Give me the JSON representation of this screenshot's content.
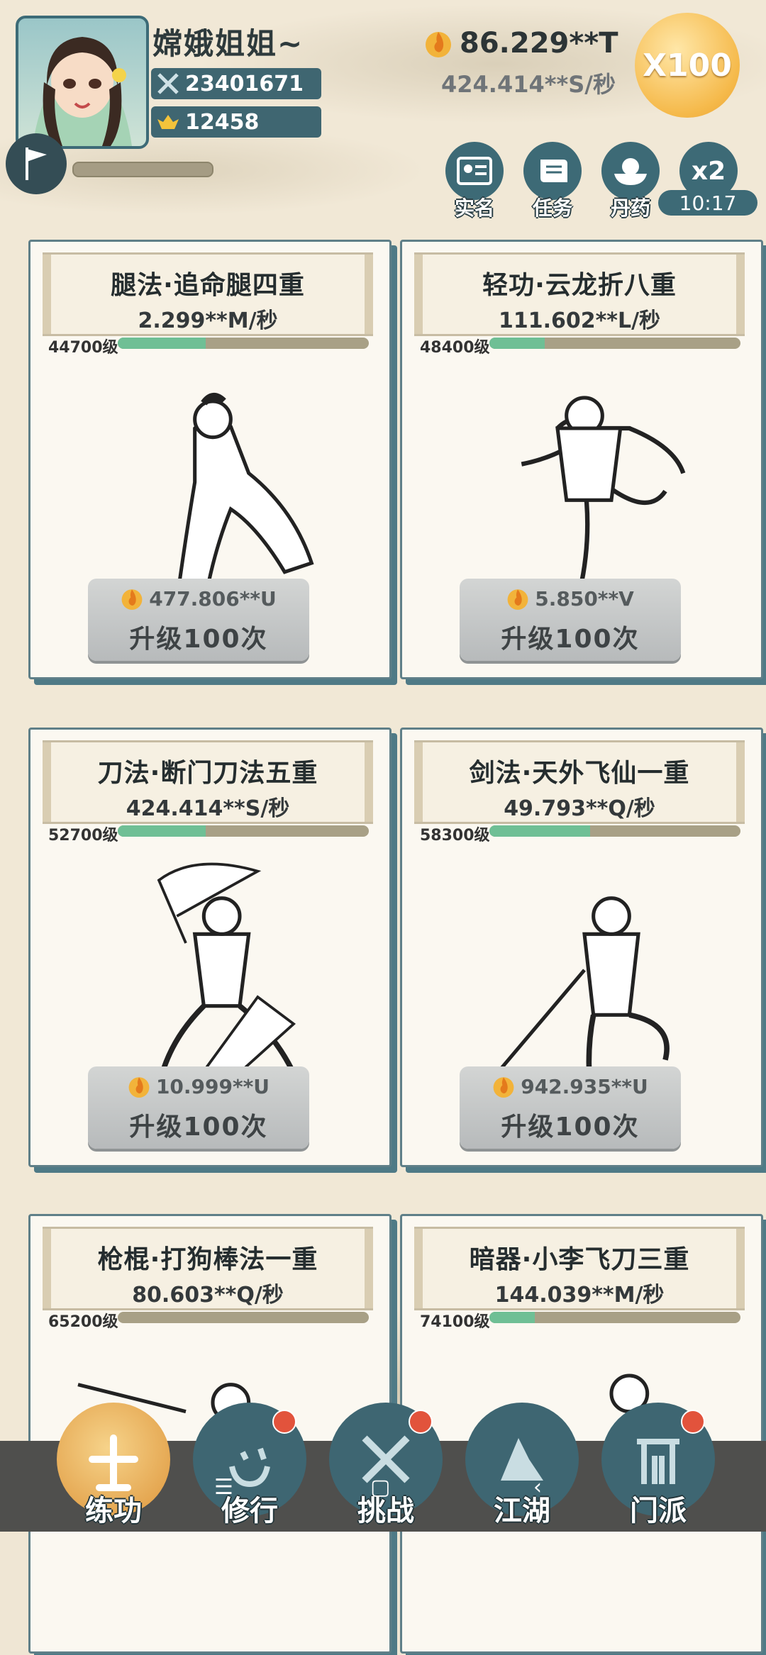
{
  "player": {
    "name": "嫦娥姐姐~",
    "power": "23401671",
    "ingots": "12458"
  },
  "currency": {
    "gold": "86.229**T",
    "rate": "424.414**S/秒"
  },
  "multiplier": "X100",
  "quick_buttons": [
    {
      "label": "实名",
      "icon": "id-card-icon"
    },
    {
      "label": "任务",
      "icon": "scroll-icon"
    },
    {
      "label": "丹药",
      "icon": "pill-bowl-icon"
    },
    {
      "label": "x2",
      "icon": "double-icon"
    }
  ],
  "boost_timer": "10:17",
  "cards": [
    {
      "name": "腿法·追命腿四重",
      "rate": "2.299**M/秒",
      "level": "44700级",
      "progress": 0.35,
      "cost": "477.806**U",
      "upgrade_label": "升级100次"
    },
    {
      "name": "轻功·云龙折八重",
      "rate": "111.602**L/秒",
      "level": "48400级",
      "progress": 0.22,
      "cost": "5.850**V",
      "upgrade_label": "升级100次"
    },
    {
      "name": "刀法·断门刀法五重",
      "rate": "424.414**S/秒",
      "level": "52700级",
      "progress": 0.35,
      "cost": "10.999**U",
      "upgrade_label": "升级100次"
    },
    {
      "name": "剑法·天外飞仙一重",
      "rate": "49.793**Q/秒",
      "level": "58300级",
      "progress": 0.4,
      "cost": "942.935**U",
      "upgrade_label": "升级100次"
    },
    {
      "name": "枪棍·打狗棒法一重",
      "rate": "80.603**Q/秒",
      "level": "65200级",
      "progress": 0.0,
      "cost": "",
      "upgrade_label": ""
    },
    {
      "name": "暗器·小李飞刀三重",
      "rate": "144.039**M/秒",
      "level": "74100级",
      "progress": 0.18,
      "cost": "",
      "upgrade_label": ""
    }
  ],
  "nav": [
    {
      "label": "练功",
      "active": true,
      "badge": false
    },
    {
      "label": "修行",
      "active": false,
      "badge": true
    },
    {
      "label": "挑战",
      "active": false,
      "badge": true
    },
    {
      "label": "江湖",
      "active": false,
      "badge": false
    },
    {
      "label": "门派",
      "active": false,
      "badge": true
    }
  ],
  "colors": {
    "accent": "#3f6671",
    "progress": "#6fbf95",
    "gold_button": "#f5b94a",
    "badge": "#e2533c"
  }
}
